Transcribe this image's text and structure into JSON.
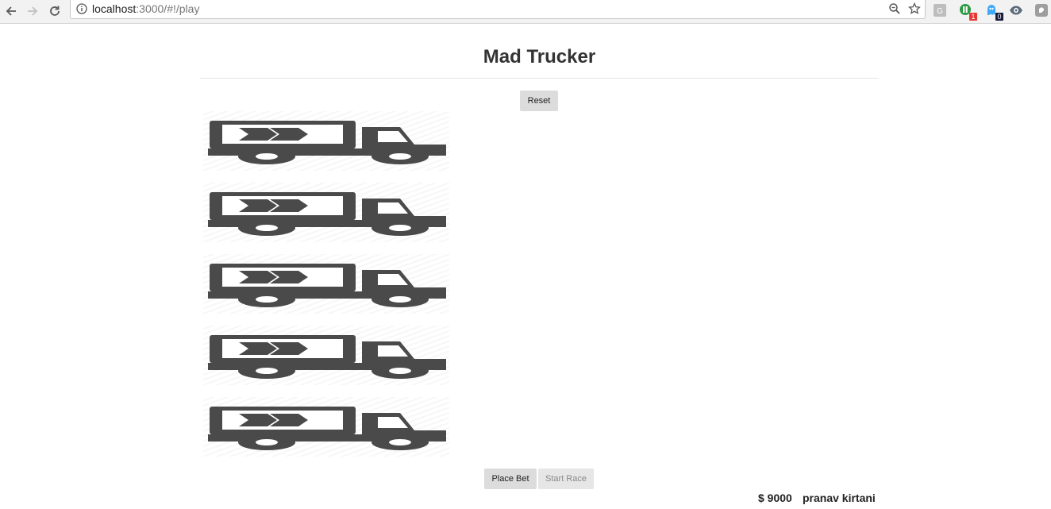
{
  "browser": {
    "url_host": "localhost",
    "url_path": ":3000/#!/play",
    "extensions": [
      {
        "icon": "g-extension-icon",
        "color": "#bdbdbd",
        "letter": "G",
        "badge": ""
      },
      {
        "icon": "green-extension-icon",
        "color": "#2e9b43",
        "letter": "",
        "badge": "1",
        "badge_color": "#e53935"
      },
      {
        "icon": "ghost-extension-icon",
        "color": "#3fa9f5",
        "letter": "",
        "badge": "0",
        "badge_color": "#1a1a3a"
      },
      {
        "icon": "eye-extension-icon",
        "color": "#5c6b7a",
        "letter": "",
        "badge": ""
      },
      {
        "icon": "shield-extension-icon",
        "color": "#9e9e9e",
        "letter": "",
        "badge": ""
      }
    ]
  },
  "page": {
    "title": "Mad Trucker",
    "reset_label": "Reset",
    "place_bet_label": "Place Bet",
    "start_race_label": "Start Race",
    "balance": "$ 9000",
    "username": "pranav kirtani"
  },
  "lanes": [
    {
      "icon": "truck-icon"
    },
    {
      "icon": "truck-icon"
    },
    {
      "icon": "truck-icon"
    },
    {
      "icon": "truck-icon"
    },
    {
      "icon": "truck-icon"
    }
  ],
  "colors": {
    "truck": "#4a4a4a",
    "button_bg": "#dcdcdc",
    "button_disabled_text": "#888888"
  }
}
